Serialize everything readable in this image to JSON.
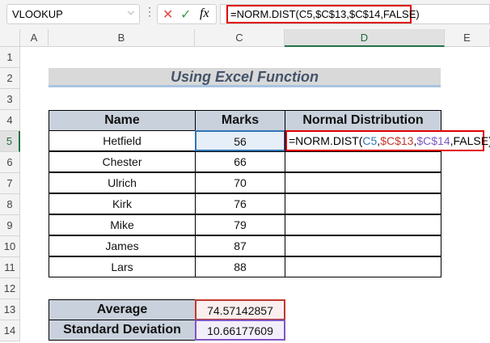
{
  "formula_bar": {
    "name_box": "VLOOKUP",
    "cancel_icon": "✕",
    "enter_icon": "✓",
    "fx_label": "fx",
    "formula": "=NORM.DIST(C5,$C$13,$C$14,FALSE)"
  },
  "columns": [
    "A",
    "B",
    "C",
    "D",
    "E"
  ],
  "rows": [
    "1",
    "2",
    "3",
    "4",
    "5",
    "6",
    "7",
    "8",
    "9",
    "10",
    "11",
    "12",
    "13",
    "14"
  ],
  "title": "Using Excel Function",
  "table": {
    "headers": [
      "Name",
      "Marks",
      "Normal Distribution"
    ],
    "rows": [
      [
        "Hetfield",
        "56"
      ],
      [
        "Chester",
        "66"
      ],
      [
        "Ulrich",
        "70"
      ],
      [
        "Kirk",
        "76"
      ],
      [
        "Mike",
        "79"
      ],
      [
        "James",
        "87"
      ],
      [
        "Lars",
        "88"
      ]
    ]
  },
  "edit_formula": {
    "prefix": "=NORM.DIST(",
    "arg1": "C5",
    "sep1": ",",
    "arg2": "$C$13",
    "sep2": ",",
    "arg3": "$C$14",
    "suffix": ",FALSE)"
  },
  "stats": [
    {
      "label": "Average",
      "value": "74.57142857"
    },
    {
      "label": "Standard Deviation",
      "value": "10.66177609"
    }
  ],
  "colors": {
    "arg1": "#2f75b5",
    "arg2": "#c0392b",
    "arg3": "#7e57c2",
    "highlight": "#e00000"
  }
}
